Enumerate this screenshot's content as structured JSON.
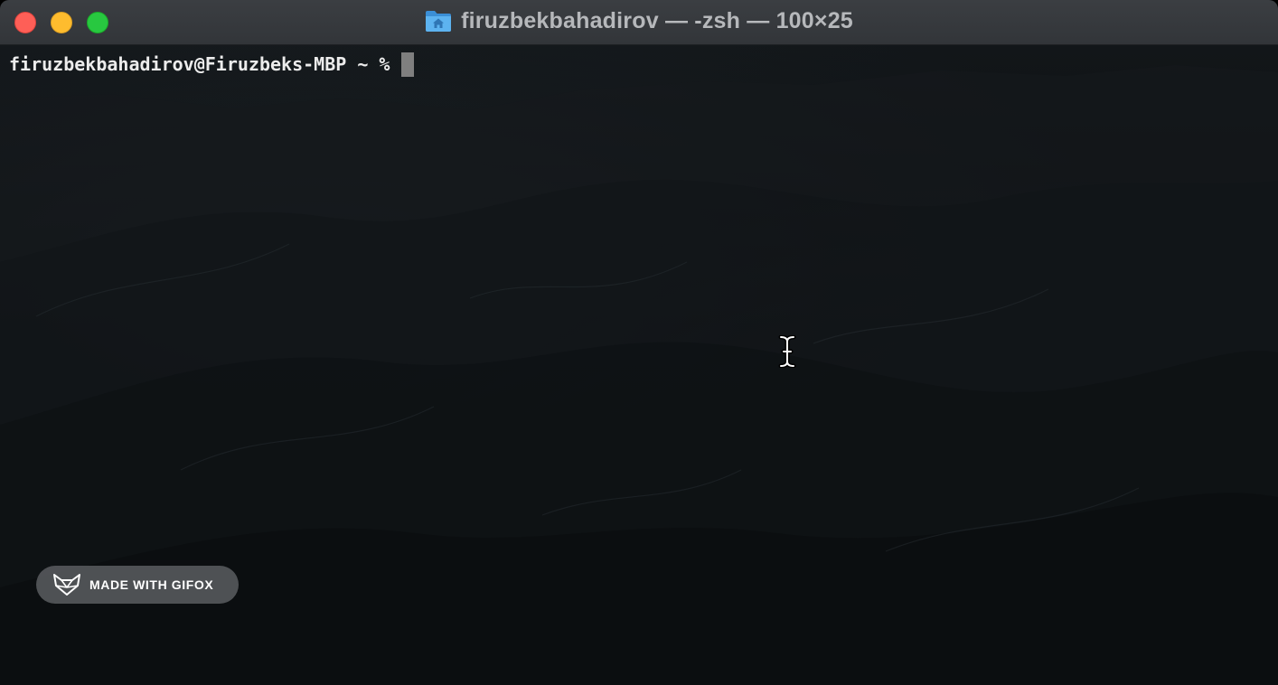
{
  "window": {
    "title": "firuzbekbahadirov — -zsh — 100×25",
    "title_icon": "home-folder-icon"
  },
  "terminal": {
    "prompt": "firuzbekbahadirov@Firuzbeks-MBP ~ %"
  },
  "watermark": {
    "label": "MADE WITH GIFOX",
    "icon": "fox-logo-icon"
  },
  "colors": {
    "close": "#fe5f57",
    "minimize": "#febc2e",
    "zoom": "#28c840",
    "folder": "#4aa3e8"
  }
}
